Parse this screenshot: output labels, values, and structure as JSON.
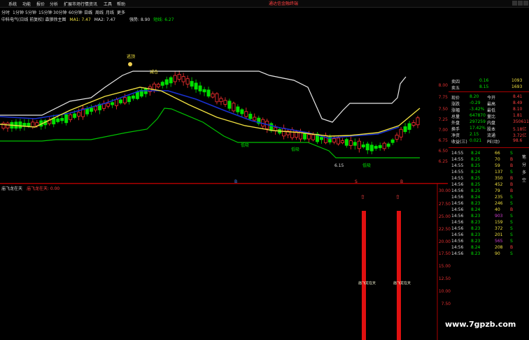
{
  "menu": {
    "items": [
      "系统",
      "功能",
      "报价",
      "分析",
      "扩展市场行情",
      "资讯",
      "工具",
      "帮助"
    ],
    "alert": "通达信金融终端"
  },
  "periods": [
    "分时",
    "1分钟",
    "5分钟",
    "15分钟",
    "30分钟",
    "60分钟",
    "日线",
    "周线",
    "月线",
    "更多"
  ],
  "indicator": {
    "title": "中科电气(日线 前复权) 森狼徐主图",
    "ma1": "MA1: 7.47",
    "ma2": "MA2: 7.47",
    "extra1": "强势: 8.90",
    "extra2": "短线: 6.27"
  },
  "lower_pane": {
    "name": "庙飞龙在天",
    "value_label": "庙飞龙在天: 0.00",
    "bar_label": "庙飞龙在天",
    "axis": [
      "30.00",
      "27.50",
      "25.00",
      "22.50",
      "20.00",
      "17.50",
      "15.00",
      "12.50",
      "10.00",
      "7.50"
    ]
  },
  "price_axis": [
    "8.00",
    "7.75",
    "7.50",
    "7.25",
    "7.00",
    "6.75",
    "6.50",
    "6.25"
  ],
  "chart_labels": {
    "top_marker": "逃顶",
    "marker2": "减仓",
    "mark_low": "6.15",
    "mark_buy": "低吸",
    "mark_buy2": "低吸",
    "mark_bottom": "低吸",
    "date_flag1": "B",
    "date_flag2": "S",
    "date_flag3": "B"
  },
  "quote": {
    "sell4_label": "卖四",
    "sell4_price": "0.16",
    "sell4_vol": "1093",
    "sell5_label": "卖五",
    "sell5_price": "8.15",
    "sell5_vol": "1693",
    "rows": [
      {
        "l1": "现价",
        "v1": "8.20",
        "l2": "今开",
        "v2": "8.41"
      },
      {
        "l1": "涨跌",
        "v1": "-0.29",
        "l2": "最高",
        "v2": "8.49"
      },
      {
        "l1": "涨幅",
        "v1": "-3.42%",
        "l2": "最低",
        "v2": "8.10"
      },
      {
        "l1": "总量",
        "v1": "647870",
        "l2": "量比",
        "v2": "1.81"
      },
      {
        "l1": "外盘",
        "v1": "297259",
        "l2": "内盘",
        "v2": "350611"
      },
      {
        "l1": "换手",
        "v1": "17.42%",
        "l2": "股本",
        "v2": "5.18亿"
      },
      {
        "l1": "净资",
        "v1": "2.15",
        "l2": "流通",
        "v2": "3.72亿"
      },
      {
        "l1": "收益(三)",
        "v1": "0.021",
        "l2": "PE(动)",
        "v2": "98.6"
      }
    ]
  },
  "ticks": [
    {
      "t": "14:55",
      "p": "8.24",
      "v": "66",
      "f": "S"
    },
    {
      "t": "14:55",
      "p": "8.25",
      "v": "70",
      "f": "B"
    },
    {
      "t": "14:55",
      "p": "8.25",
      "v": "59",
      "f": "B"
    },
    {
      "t": "14:55",
      "p": "8.24",
      "v": "137",
      "f": "S"
    },
    {
      "t": "14:55",
      "p": "8.25",
      "v": "350",
      "f": "B"
    },
    {
      "t": "14:56",
      "p": "8.25",
      "v": "452",
      "f": "B"
    },
    {
      "t": "14:56",
      "p": "8.25",
      "v": "79",
      "f": "B"
    },
    {
      "t": "14:56",
      "p": "8.24",
      "v": "235",
      "f": "S"
    },
    {
      "t": "14:56",
      "p": "8.23",
      "v": "246",
      "f": "S"
    },
    {
      "t": "14:56",
      "p": "8.24",
      "v": "40",
      "f": "B"
    },
    {
      "t": "14:56",
      "p": "8.23",
      "v": "903",
      "f": "S"
    },
    {
      "t": "14:56",
      "p": "8.23",
      "v": "159",
      "f": "S"
    },
    {
      "t": "14:56",
      "p": "8.23",
      "v": "372",
      "f": "S"
    },
    {
      "t": "14:56",
      "p": "8.23",
      "v": "201",
      "f": "S"
    },
    {
      "t": "14:56",
      "p": "8.23",
      "v": "565",
      "f": "S"
    },
    {
      "t": "14:56",
      "p": "8.24",
      "v": "208",
      "f": "B"
    },
    {
      "t": "14:56",
      "p": "8.23",
      "v": "90",
      "f": "S"
    }
  ],
  "side_buttons": [
    "笔",
    "分",
    "多",
    "空"
  ],
  "watermark": "www.7gpzb.com",
  "colors": {
    "up": "#ff3232",
    "down": "#00e000",
    "ma_yellow": "#f0e040",
    "ma_blue": "#1830d0",
    "band_white": "#e8e8e8",
    "band_green": "#00c000"
  }
}
